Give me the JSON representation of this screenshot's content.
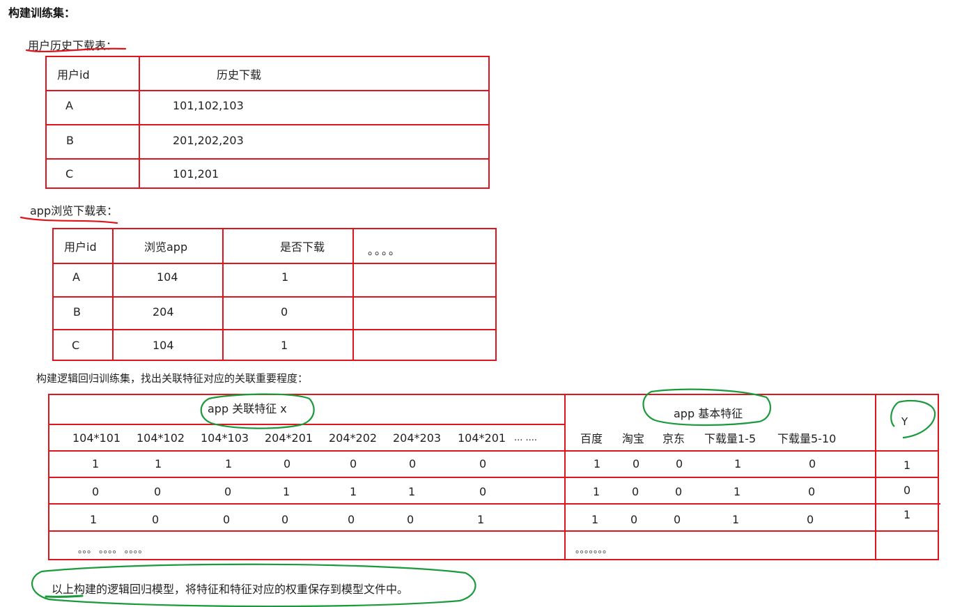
{
  "title": "构建训练集：",
  "table1": {
    "caption": "用户历史下载表：",
    "headers": [
      "用户id",
      "历史下载"
    ],
    "rows": [
      [
        "A",
        "101,102,103"
      ],
      [
        "B",
        "201,202,203"
      ],
      [
        "C",
        "101,201"
      ]
    ]
  },
  "table2": {
    "caption": "app浏览下载表：",
    "headers": [
      "用户id",
      "浏览app",
      "是否下载",
      "。。。。"
    ],
    "rows": [
      [
        "A",
        "104",
        "1"
      ],
      [
        "B",
        "204",
        "0"
      ],
      [
        "C",
        "104",
        "1"
      ]
    ]
  },
  "table3": {
    "caption": "构建逻辑回归训练集，找出关联特征对应的关联重要程度：",
    "group_headers": [
      "app 关联特征 x",
      "app 基本特征",
      "Y"
    ],
    "cross_columns": [
      "104*101",
      "104*102",
      "104*103",
      "204*201",
      "204*202",
      "204*203",
      "104*201",
      "... ...."
    ],
    "basic_columns": [
      "百度",
      "淘宝",
      "京东",
      "下载量1-5",
      "下载量5-10"
    ],
    "rows": [
      {
        "cross": [
          "1",
          "1",
          "1",
          "0",
          "0",
          "0",
          "0"
        ],
        "basic": [
          "1",
          "0",
          "0",
          "1",
          "0"
        ],
        "y": "1"
      },
      {
        "cross": [
          "0",
          "0",
          "0",
          "1",
          "1",
          "1",
          "0"
        ],
        "basic": [
          "1",
          "0",
          "0",
          "1",
          "0"
        ],
        "y": "0"
      },
      {
        "cross": [
          "1",
          "0",
          "0",
          "0",
          "0",
          "0",
          "1"
        ],
        "basic": [
          "1",
          "0",
          "0",
          "1",
          "0"
        ],
        "y": "1"
      }
    ],
    "ellipsis_left": "。。。 。。。。 。。。。",
    "ellipsis_right": "。。。。。。。"
  },
  "footer": "以上构建的逻辑回归模型，将特征和特征对应的权重保存到模型文件中。",
  "colors": {
    "table_border": "#e0141c",
    "red_annotation": "#e0141c",
    "green_annotation": "#1a9a3a"
  }
}
